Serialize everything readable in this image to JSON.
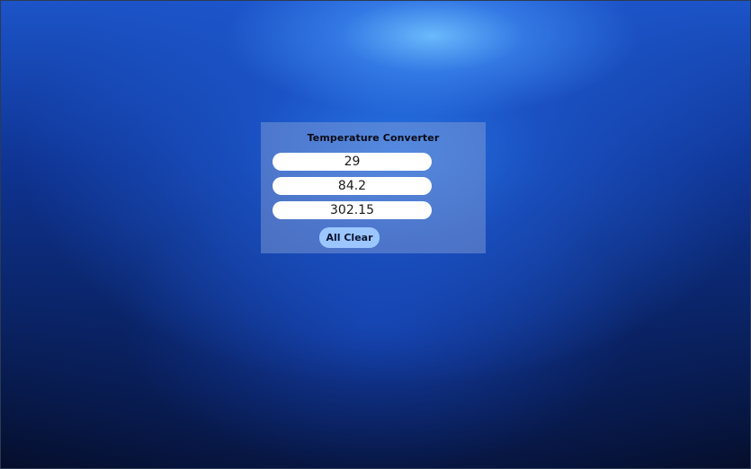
{
  "converter": {
    "title": "Temperature Converter",
    "inputs": {
      "celsius": "29",
      "fahrenheit": "84.2",
      "kelvin": "302.15"
    },
    "clear_label": "All Clear"
  },
  "colors": {
    "panel_background": "#8ca5d7",
    "button_background": "#9cc6ff",
    "input_background": "#ffffff"
  }
}
